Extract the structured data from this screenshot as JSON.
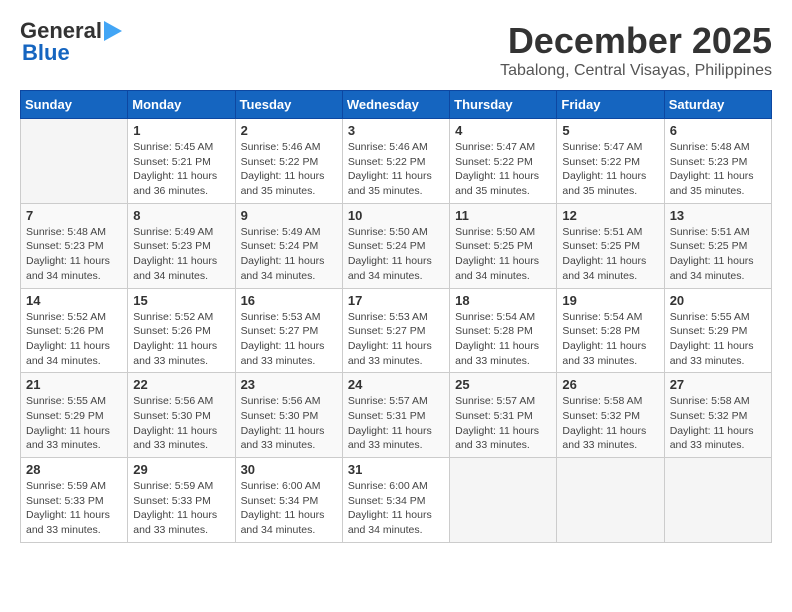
{
  "header": {
    "logo_line1": "General",
    "logo_line2": "Blue",
    "month": "December 2025",
    "location": "Tabalong, Central Visayas, Philippines"
  },
  "weekdays": [
    "Sunday",
    "Monday",
    "Tuesday",
    "Wednesday",
    "Thursday",
    "Friday",
    "Saturday"
  ],
  "weeks": [
    [
      {
        "day": "",
        "info": ""
      },
      {
        "day": "1",
        "info": "Sunrise: 5:45 AM\nSunset: 5:21 PM\nDaylight: 11 hours\nand 36 minutes."
      },
      {
        "day": "2",
        "info": "Sunrise: 5:46 AM\nSunset: 5:22 PM\nDaylight: 11 hours\nand 35 minutes."
      },
      {
        "day": "3",
        "info": "Sunrise: 5:46 AM\nSunset: 5:22 PM\nDaylight: 11 hours\nand 35 minutes."
      },
      {
        "day": "4",
        "info": "Sunrise: 5:47 AM\nSunset: 5:22 PM\nDaylight: 11 hours\nand 35 minutes."
      },
      {
        "day": "5",
        "info": "Sunrise: 5:47 AM\nSunset: 5:22 PM\nDaylight: 11 hours\nand 35 minutes."
      },
      {
        "day": "6",
        "info": "Sunrise: 5:48 AM\nSunset: 5:23 PM\nDaylight: 11 hours\nand 35 minutes."
      }
    ],
    [
      {
        "day": "7",
        "info": "Sunrise: 5:48 AM\nSunset: 5:23 PM\nDaylight: 11 hours\nand 34 minutes."
      },
      {
        "day": "8",
        "info": "Sunrise: 5:49 AM\nSunset: 5:23 PM\nDaylight: 11 hours\nand 34 minutes."
      },
      {
        "day": "9",
        "info": "Sunrise: 5:49 AM\nSunset: 5:24 PM\nDaylight: 11 hours\nand 34 minutes."
      },
      {
        "day": "10",
        "info": "Sunrise: 5:50 AM\nSunset: 5:24 PM\nDaylight: 11 hours\nand 34 minutes."
      },
      {
        "day": "11",
        "info": "Sunrise: 5:50 AM\nSunset: 5:25 PM\nDaylight: 11 hours\nand 34 minutes."
      },
      {
        "day": "12",
        "info": "Sunrise: 5:51 AM\nSunset: 5:25 PM\nDaylight: 11 hours\nand 34 minutes."
      },
      {
        "day": "13",
        "info": "Sunrise: 5:51 AM\nSunset: 5:25 PM\nDaylight: 11 hours\nand 34 minutes."
      }
    ],
    [
      {
        "day": "14",
        "info": "Sunrise: 5:52 AM\nSunset: 5:26 PM\nDaylight: 11 hours\nand 34 minutes."
      },
      {
        "day": "15",
        "info": "Sunrise: 5:52 AM\nSunset: 5:26 PM\nDaylight: 11 hours\nand 33 minutes."
      },
      {
        "day": "16",
        "info": "Sunrise: 5:53 AM\nSunset: 5:27 PM\nDaylight: 11 hours\nand 33 minutes."
      },
      {
        "day": "17",
        "info": "Sunrise: 5:53 AM\nSunset: 5:27 PM\nDaylight: 11 hours\nand 33 minutes."
      },
      {
        "day": "18",
        "info": "Sunrise: 5:54 AM\nSunset: 5:28 PM\nDaylight: 11 hours\nand 33 minutes."
      },
      {
        "day": "19",
        "info": "Sunrise: 5:54 AM\nSunset: 5:28 PM\nDaylight: 11 hours\nand 33 minutes."
      },
      {
        "day": "20",
        "info": "Sunrise: 5:55 AM\nSunset: 5:29 PM\nDaylight: 11 hours\nand 33 minutes."
      }
    ],
    [
      {
        "day": "21",
        "info": "Sunrise: 5:55 AM\nSunset: 5:29 PM\nDaylight: 11 hours\nand 33 minutes."
      },
      {
        "day": "22",
        "info": "Sunrise: 5:56 AM\nSunset: 5:30 PM\nDaylight: 11 hours\nand 33 minutes."
      },
      {
        "day": "23",
        "info": "Sunrise: 5:56 AM\nSunset: 5:30 PM\nDaylight: 11 hours\nand 33 minutes."
      },
      {
        "day": "24",
        "info": "Sunrise: 5:57 AM\nSunset: 5:31 PM\nDaylight: 11 hours\nand 33 minutes."
      },
      {
        "day": "25",
        "info": "Sunrise: 5:57 AM\nSunset: 5:31 PM\nDaylight: 11 hours\nand 33 minutes."
      },
      {
        "day": "26",
        "info": "Sunrise: 5:58 AM\nSunset: 5:32 PM\nDaylight: 11 hours\nand 33 minutes."
      },
      {
        "day": "27",
        "info": "Sunrise: 5:58 AM\nSunset: 5:32 PM\nDaylight: 11 hours\nand 33 minutes."
      }
    ],
    [
      {
        "day": "28",
        "info": "Sunrise: 5:59 AM\nSunset: 5:33 PM\nDaylight: 11 hours\nand 33 minutes."
      },
      {
        "day": "29",
        "info": "Sunrise: 5:59 AM\nSunset: 5:33 PM\nDaylight: 11 hours\nand 33 minutes."
      },
      {
        "day": "30",
        "info": "Sunrise: 6:00 AM\nSunset: 5:34 PM\nDaylight: 11 hours\nand 34 minutes."
      },
      {
        "day": "31",
        "info": "Sunrise: 6:00 AM\nSunset: 5:34 PM\nDaylight: 11 hours\nand 34 minutes."
      },
      {
        "day": "",
        "info": ""
      },
      {
        "day": "",
        "info": ""
      },
      {
        "day": "",
        "info": ""
      }
    ]
  ]
}
